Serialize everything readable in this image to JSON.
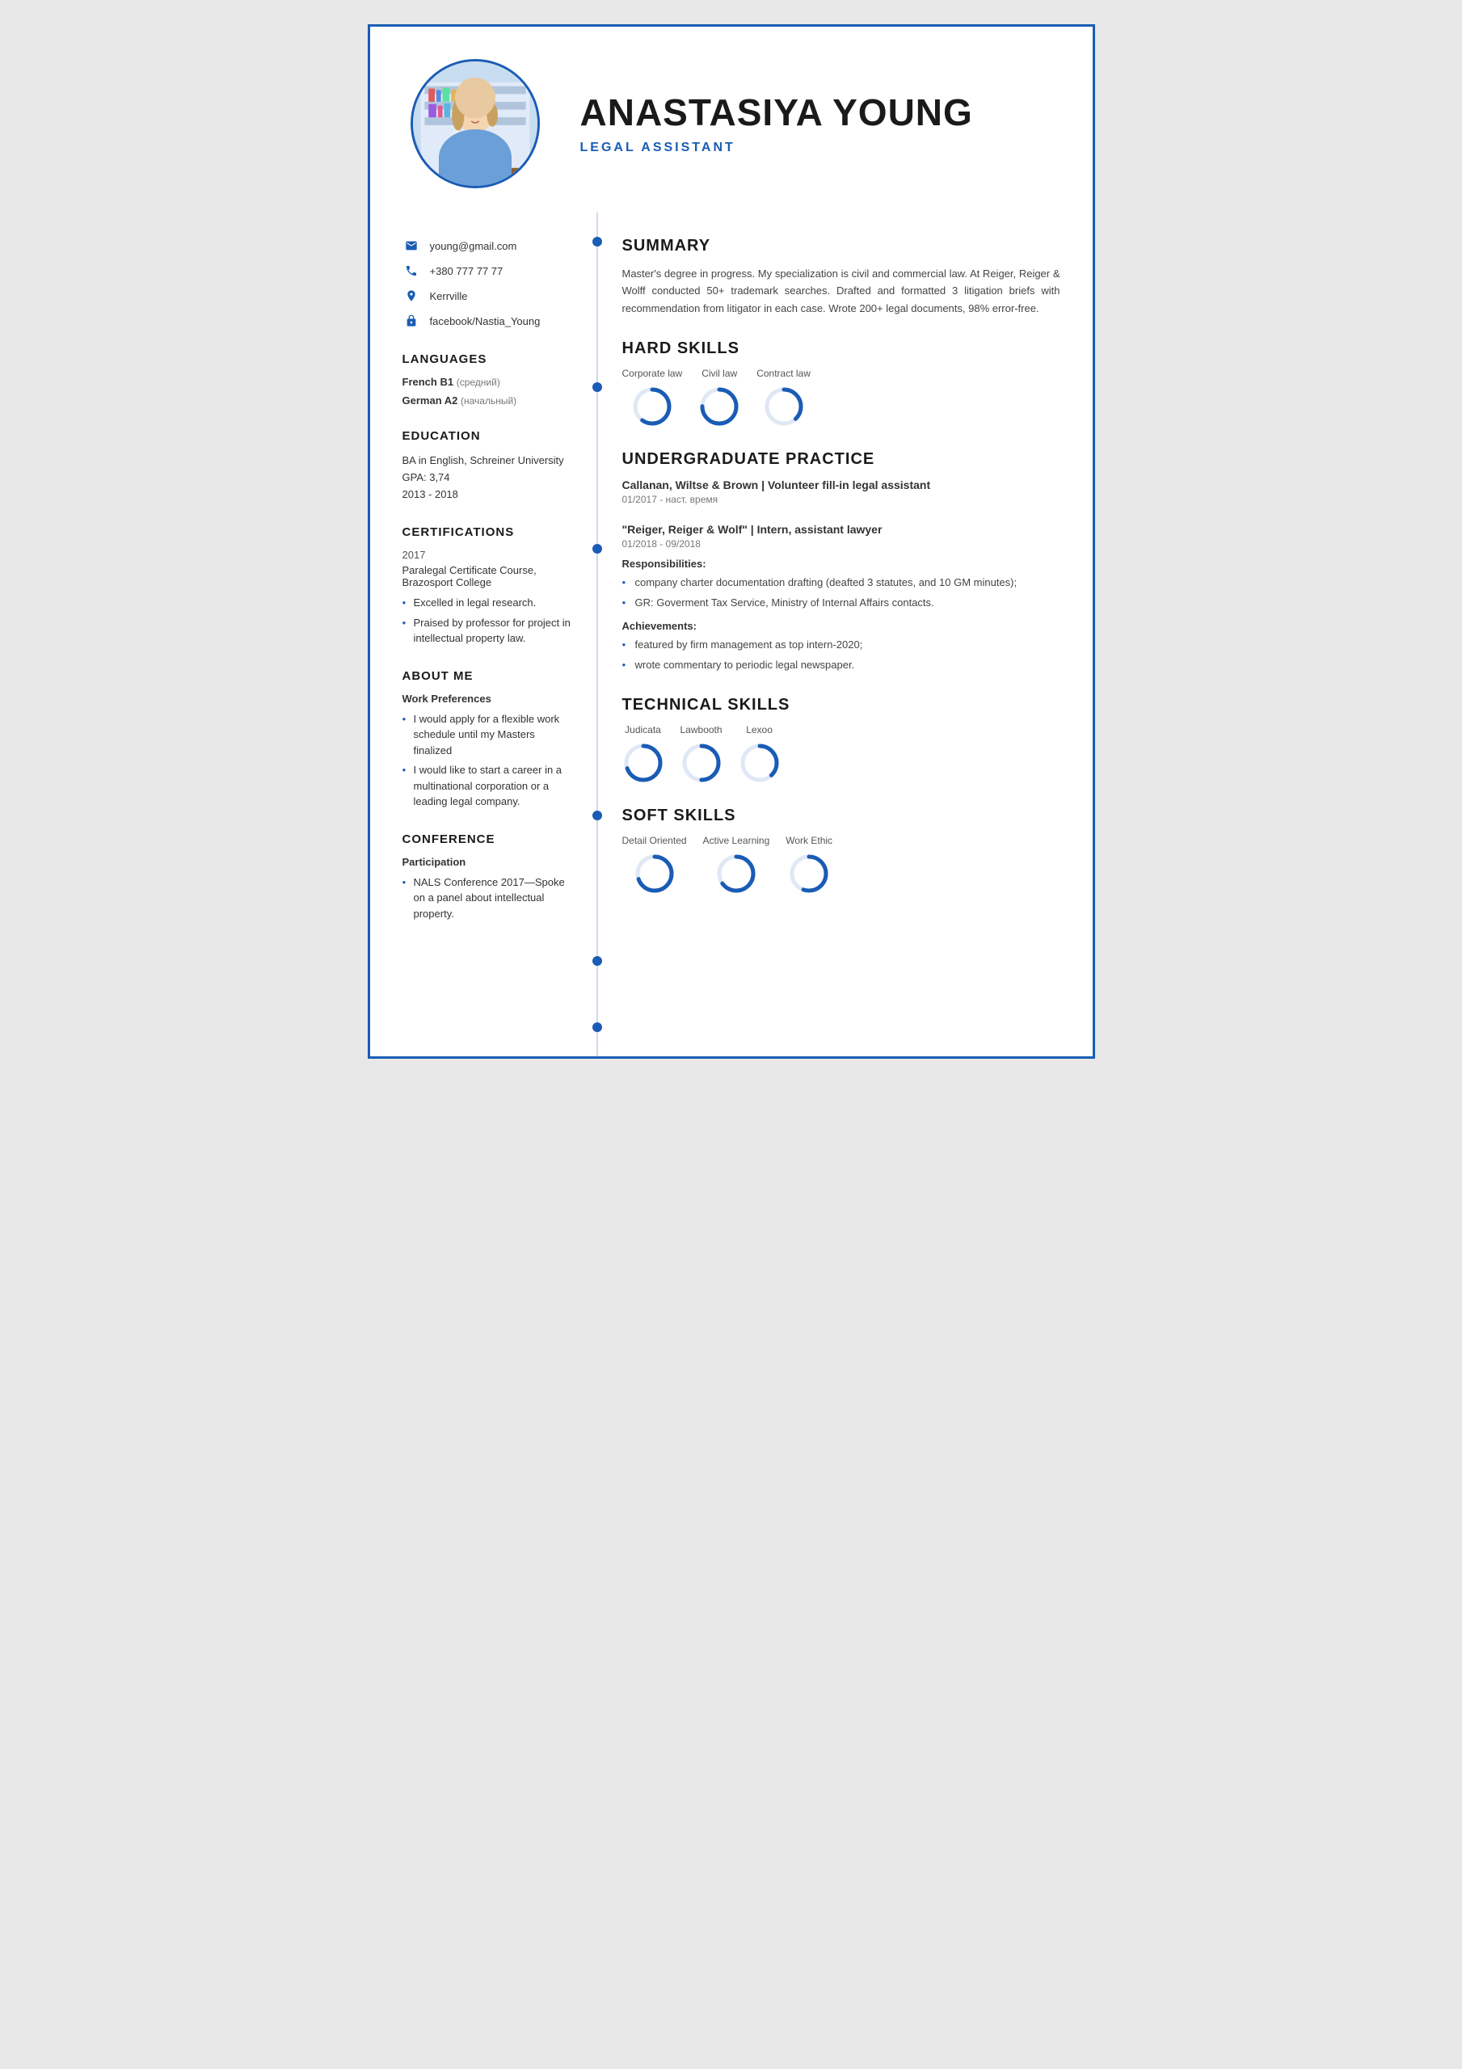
{
  "header": {
    "name": "ANASTASIYA YOUNG",
    "job_title": "LEGAL ASSISTANT"
  },
  "contact": {
    "email": "young@gmail.com",
    "phone": "+380 777 77 77",
    "location": "Kerrville",
    "social": "facebook/Nastia_Young"
  },
  "languages": {
    "title": "LANGUAGES",
    "items": [
      {
        "lang": "French",
        "level": "B1",
        "note": "(средний)"
      },
      {
        "lang": "German",
        "level": "A2",
        "note": "(начальный)"
      }
    ]
  },
  "education": {
    "title": "EDUCATION",
    "degree": "BA in English, Schreiner University",
    "gpa": "GPA: 3,74",
    "years": "2013 - 2018"
  },
  "certifications": {
    "title": "CERTIFICATIONS",
    "year": "2017",
    "name": "Paralegal Certificate Course, Brazosport College",
    "bullets": [
      "Excelled in legal research.",
      "Praised by professor for project in intellectual property law."
    ]
  },
  "about": {
    "title": "ABOUT ME",
    "work_pref_title": "Work Preferences",
    "bullets": [
      "I would apply for a flexible work schedule until my Masters finalized",
      "I would like to start a career in a multinational corporation or a leading legal company."
    ]
  },
  "conference": {
    "title": "CONFERENCE",
    "sub": "Participation",
    "bullets": [
      "NALS Conference 2017—Spoke on a panel about intellectual property."
    ]
  },
  "summary": {
    "title": "SUMMARY",
    "text": "Master's degree in progress. My specialization is civil and commercial law. At Reiger, Reiger & Wolff conducted 50+ trademark searches. Drafted and formatted 3 litigation briefs with recommendation from litigator in each case. Wrote 200+ legal documents, 98% error-free."
  },
  "hard_skills": {
    "title": "HARD SKILLS",
    "items": [
      {
        "label": "Corporate law",
        "pct": 60
      },
      {
        "label": "Civil law",
        "pct": 75
      },
      {
        "label": "Contract law",
        "pct": 40
      }
    ]
  },
  "undergrad_practice": {
    "title": "UNDERGRADUATE PRACTICE",
    "entries": [
      {
        "org": "Callanan, Wiltse & Brown | Volunteer fill-in legal assistant",
        "date": "01/2017 - наст. время",
        "responsibilities": [],
        "achievements": []
      },
      {
        "org": "\"Reiger, Reiger & Wolf\" | Intern, assistant lawyer",
        "date": "01/2018 - 09/2018",
        "resp_title": "Responsibilities:",
        "responsibilities": [
          "company charter documentation drafting (deafted 3 statutes, and 10 GM minutes);",
          "GR: Goverment Tax Service, Ministry of Internal Affairs contacts."
        ],
        "ach_title": "Achievements:",
        "achievements": [
          "featured by firm management as top intern-2020;",
          "wrote commentary to periodic legal newspaper."
        ]
      }
    ]
  },
  "technical_skills": {
    "title": "TECHNICAL SKILLS",
    "items": [
      {
        "label": "Judicata",
        "pct": 70
      },
      {
        "label": "Lawbooth",
        "pct": 50
      },
      {
        "label": "Lexoo",
        "pct": 40
      }
    ]
  },
  "soft_skills": {
    "title": "SOFT SKILLS",
    "items": [
      {
        "label": "Detail Oriented",
        "pct": 70
      },
      {
        "label": "Active Learning",
        "pct": 65
      },
      {
        "label": "Work Ethic",
        "pct": 55
      }
    ]
  },
  "timeline_dots": {
    "positions": [
      "summary",
      "hard_skills",
      "undergrad",
      "technical",
      "soft",
      "bottom"
    ]
  }
}
